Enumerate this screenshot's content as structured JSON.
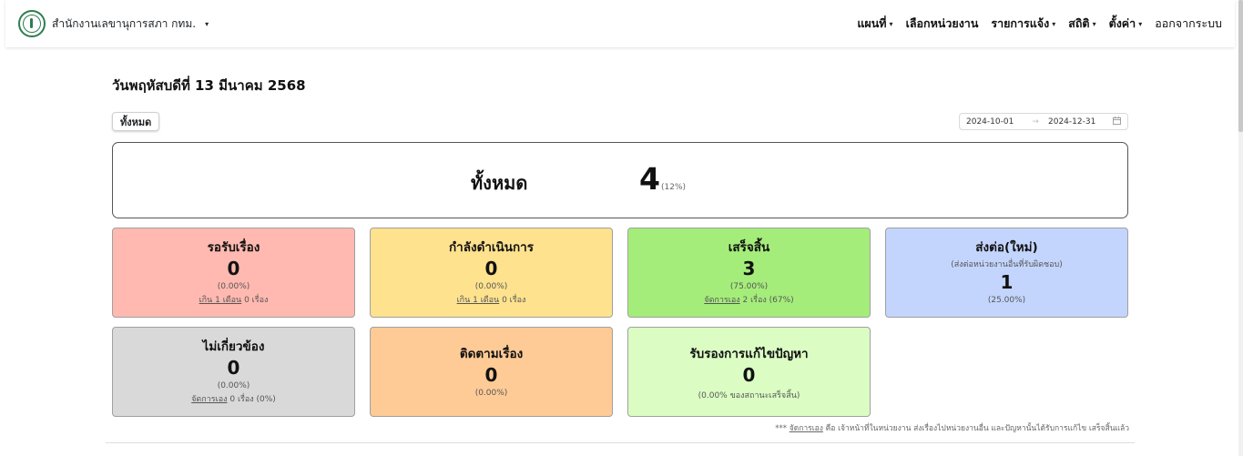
{
  "header": {
    "brand": "สำนักงานเลขานุการสภา กทม.",
    "nav": [
      {
        "label": "แผนที่",
        "caret": "▾"
      },
      {
        "label": "เลือกหน่วยงาน",
        "caret": ""
      },
      {
        "label": "รายการแจ้ง",
        "caret": "▾"
      },
      {
        "label": "สถิติ",
        "caret": "▾"
      },
      {
        "label": "ตั้งค่า",
        "caret": "▾"
      },
      {
        "label": "ออกจากระบบ",
        "caret": ""
      }
    ]
  },
  "page": {
    "date_title": "วันพฤหัสบดีที่ 13 มีนาคม 2568",
    "filter_all": "ทั้งหมด",
    "range_start": "2024-10-01",
    "range_arrow": "→",
    "range_end": "2024-12-31"
  },
  "total": {
    "label": "ทั้งหมด",
    "value": "4",
    "pct": "(12%)"
  },
  "cards": {
    "pending": {
      "title": "รอรับเรื่อง",
      "value": "0",
      "pct": "(0.00%)",
      "link": "เกิน 1 เดือน",
      "detail": " 0 เรื่อง",
      "color": "#ffb9b0"
    },
    "in_progress": {
      "title": "กำลังดำเนินการ",
      "value": "0",
      "pct": "(0.00%)",
      "link": "เกิน 1 เดือน",
      "detail": " 0 เรื่อง",
      "color": "#fee28e"
    },
    "done": {
      "title": "เสร็จสิ้น",
      "value": "3",
      "pct": "(75.00%)",
      "link": "จัดการเอง",
      "detail": " 2 เรื่อง (67%)",
      "color": "#a5ed7a"
    },
    "forwarded": {
      "title": "ส่งต่อ(ใหม่)",
      "sub": "(ส่งต่อหน่วยงานอื่นที่รับผิดชอบ)",
      "value": "1",
      "pct": "(25.00%)",
      "color": "#c3d5fd"
    },
    "irrelevant": {
      "title": "ไม่เกี่ยวข้อง",
      "value": "0",
      "pct": "(0.00%)",
      "link": "จัดการเอง",
      "detail": " 0 เรื่อง (0%)",
      "color": "#d9d9d9"
    },
    "follow_up": {
      "title": "ติดตามเรื่อง",
      "value": "0",
      "pct": "(0.00%)",
      "color": "#fecb96"
    },
    "certify": {
      "title": "รับรองการแก้ไขปัญหา",
      "value": "0",
      "pct": "(0.00% ของสถานะเสร็จสิ้น)",
      "color": "#dbfdc4"
    }
  },
  "footnote": {
    "prefix": "*** ",
    "link": "จัดการเอง",
    "text": " คือ เจ้าหน้าที่ในหน่วยงาน ส่งเรื่องไปหน่วยงานอื่น และปัญหานั้นได้รับการแก้ไข เสร็จสิ้นแล้ว"
  }
}
